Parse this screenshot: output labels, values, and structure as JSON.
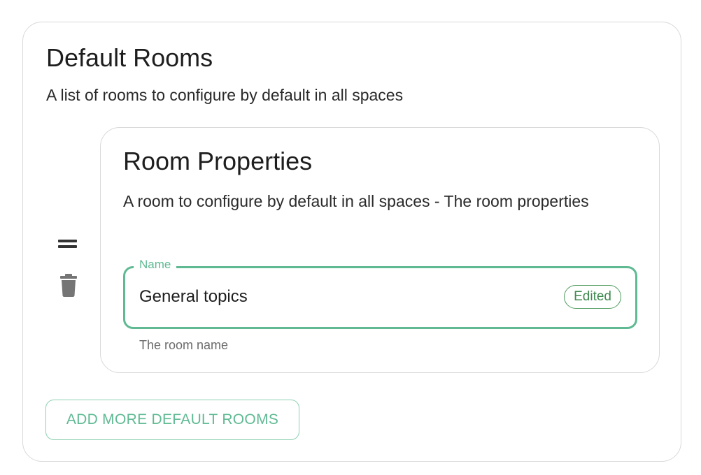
{
  "section": {
    "title": "Default Rooms",
    "description": "A list of rooms to configure by default in all spaces"
  },
  "room_item": {
    "title": "Room Properties",
    "description": "A room to configure by default in all spaces - The room properties",
    "name_field": {
      "label": "Name",
      "value": "General topics",
      "badge": "Edited",
      "helper": "The room name"
    },
    "controls": {
      "drag_icon": "drag-handle-icon",
      "delete_icon": "trash-icon"
    }
  },
  "actions": {
    "add_label": "ADD MORE DEFAULT ROOMS"
  },
  "colors": {
    "accent": "#5fba93",
    "badge": "#3f8a4f",
    "border": "#d9d9d9",
    "icon": "#333333",
    "helper": "#6b6b6b"
  }
}
